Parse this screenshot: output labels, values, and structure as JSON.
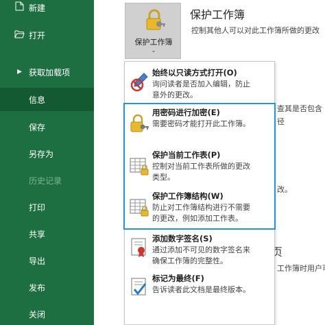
{
  "sidebar": {
    "items": [
      {
        "label": "新建"
      },
      {
        "label": "打开"
      },
      {
        "label": "获取加载项"
      },
      {
        "label": "信息"
      },
      {
        "label": "保存"
      },
      {
        "label": "另存为"
      },
      {
        "label": "历史记录"
      },
      {
        "label": "打印"
      },
      {
        "label": "共享"
      },
      {
        "label": "导出"
      },
      {
        "label": "发布"
      },
      {
        "label": "关闭"
      }
    ],
    "active": "信息",
    "background": "#1d6f42",
    "active_background": "#135a33"
  },
  "main": {
    "protect_button_label": "保护工作簿",
    "section_title": "保护工作簿",
    "section_desc": "控制其他人可以对此工作簿所做的更改",
    "fragments": [
      "查其是否包含",
      "径",
      "改。",
      "工作簿时用户可"
    ],
    "fragment_big": "页"
  },
  "menu": {
    "items": [
      {
        "title": "始终以只读方式打开(O)",
        "desc": [
          "询问读者是否加入编辑，防止",
          "意外的更改。"
        ],
        "icon": "pencil-no-icon"
      },
      {
        "title": "用密码进行加密(E)",
        "desc": [
          "需要密码才能打开此工作簿。"
        ],
        "icon": "lock-key-icon"
      },
      {
        "title": "保护当前工作表(P)",
        "desc": [
          "控制对当前工作表所做的更改",
          "类型。"
        ],
        "icon": "sheet-lock-icon"
      },
      {
        "title": "保护工作簿结构(W)",
        "desc": [
          "防止对工作簿结构进行不需要",
          "的更改，例如添加工作表。"
        ],
        "icon": "workbook-lock-icon"
      },
      {
        "title": "添加数字签名(S)",
        "desc": [
          "通过添加不可见的数字签名来",
          "确保工作簿的完整性。"
        ],
        "icon": "certificate-icon"
      },
      {
        "title": "标记为最终(F)",
        "desc": [
          "告诉读者此文档是最终版本。"
        ],
        "icon": "final-check-icon"
      }
    ],
    "highlight_color": "#1f94e0"
  }
}
